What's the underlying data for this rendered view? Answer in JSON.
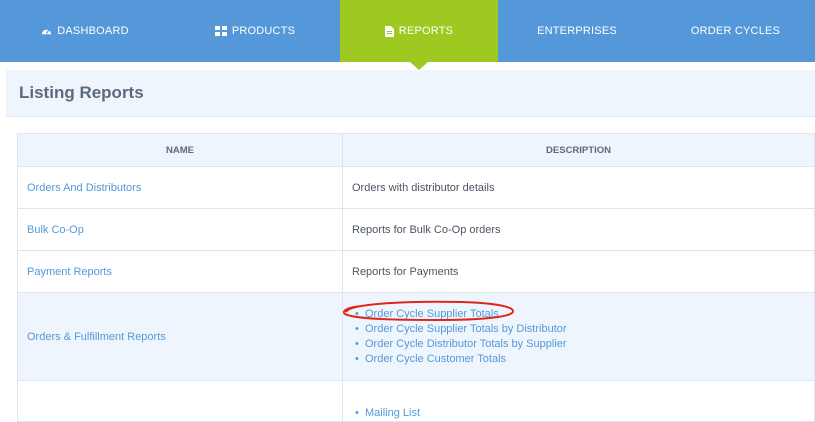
{
  "nav": {
    "items": [
      {
        "label": "DASHBOARD",
        "icon": "dashboard-icon"
      },
      {
        "label": "PRODUCTS",
        "icon": "products-grid-icon"
      },
      {
        "label": "REPORTS",
        "icon": "report-document-icon",
        "active": true
      },
      {
        "label": "ENTERPRISES"
      },
      {
        "label": "ORDER CYCLES"
      }
    ]
  },
  "page": {
    "title": "Listing Reports"
  },
  "table": {
    "headers": {
      "name": "NAME",
      "description": "DESCRIPTION"
    },
    "rows": [
      {
        "name": "Orders And Distributors",
        "description": "Orders with distributor details"
      },
      {
        "name": "Bulk Co-Op",
        "description": "Reports for Bulk Co-Op orders"
      },
      {
        "name": "Payment Reports",
        "description": "Reports for Payments"
      },
      {
        "name": "Orders & Fulfillment Reports",
        "links": [
          "Order Cycle Supplier Totals",
          "Order Cycle Supplier Totals by Distributor",
          "Order Cycle Distributor Totals by Supplier",
          "Order Cycle Customer Totals"
        ]
      },
      {
        "name": "",
        "links": [
          "Mailing List"
        ]
      }
    ]
  },
  "colors": {
    "nav_bg": "#5498da",
    "nav_active": "#9fc820",
    "link": "#5498da",
    "header_bg": "#eff5fc",
    "annotation": "#e0261b"
  }
}
